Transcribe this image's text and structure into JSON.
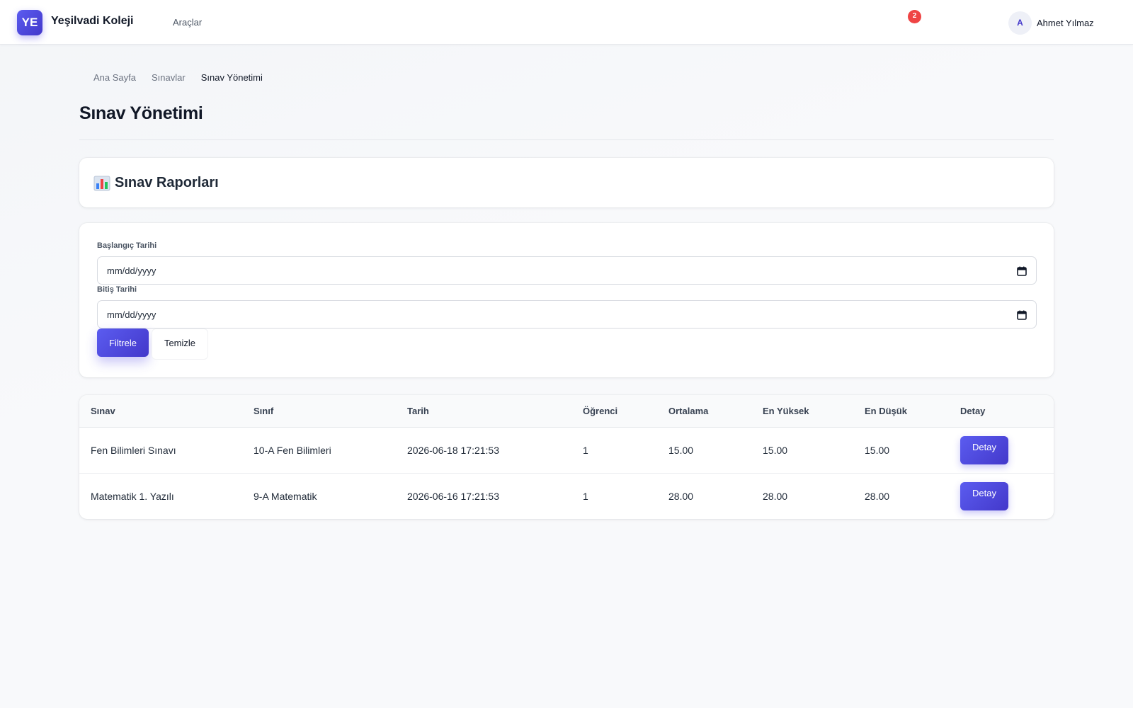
{
  "navbar": {
    "logo_text": "YE",
    "brand_name": "Yeşilvadi Koleji",
    "links": [
      "Araçlar"
    ],
    "notification_count": "2",
    "user": {
      "initial": "A",
      "name": "Ahmet Yılmaz"
    }
  },
  "breadcrumb": [
    "Ana Sayfa",
    "Sınavlar",
    "Sınav Yönetimi"
  ],
  "page_title": "Sınav Yönetimi",
  "reports": {
    "icon": "bar-chart-icon",
    "title": "Sınav Raporları"
  },
  "filter": {
    "start_label": "Başlangıç Tarihi",
    "start_value": "mm/dd/yyyy",
    "end_label": "Bitiş Tarihi",
    "end_value": "mm/dd/yyyy",
    "filter_button": "Filtrele",
    "clear_button": "Temizle"
  },
  "table": {
    "columns": [
      "Sınav",
      "Sınıf",
      "Tarih",
      "Öğrenci",
      "Ortalama",
      "En Yüksek",
      "En Düşük",
      "Detay"
    ],
    "rows": [
      [
        "Fen Bilimleri Sınavı",
        "10-A Fen Bilimleri",
        "2026-06-18 17:21:53",
        "1",
        "15.00",
        "15.00",
        "15.00",
        "Detay"
      ],
      [
        "Matematik 1. Yazılı",
        "9-A Matematik",
        "2026-06-16 17:21:53",
        "1",
        "28.00",
        "28.00",
        "28.00",
        "Detay"
      ]
    ]
  },
  "colors": {
    "accent": "#4f46e5",
    "badge": "#ef4444"
  }
}
